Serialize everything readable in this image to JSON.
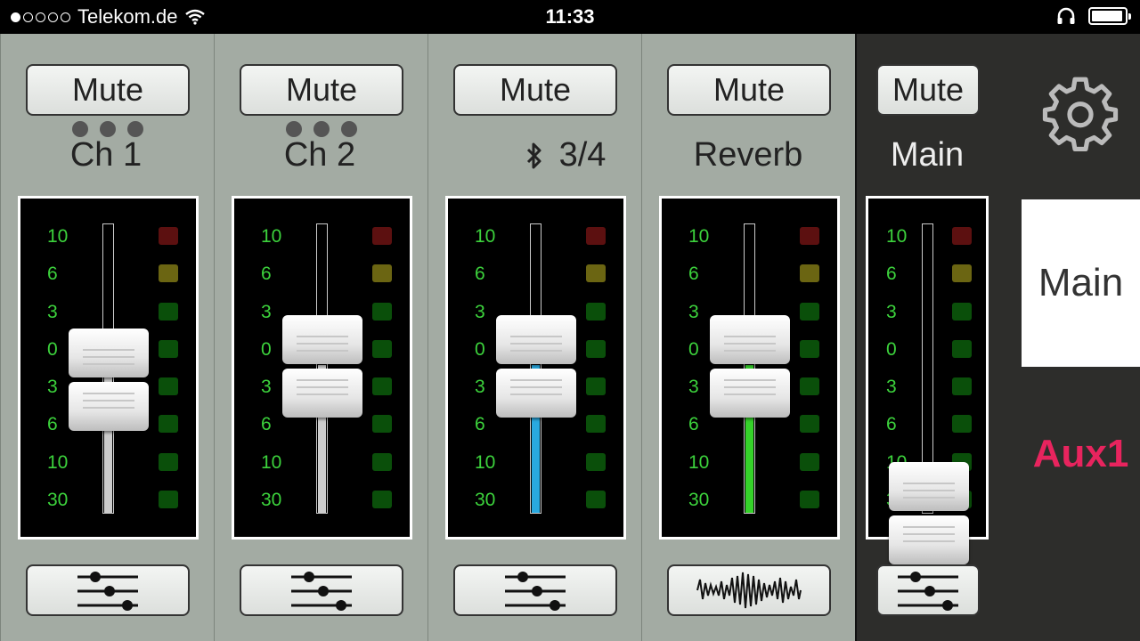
{
  "status_bar": {
    "signal_dots": [
      true,
      false,
      false,
      false,
      false
    ],
    "carrier": "Telekom.de",
    "time": "11:33"
  },
  "channels": [
    {
      "mute_label": "Mute",
      "name": "Ch 1",
      "linked": true,
      "bluetooth": false,
      "fader_color": "#cccccc",
      "edit_icon": "sliders-icon"
    },
    {
      "mute_label": "Mute",
      "name": "Ch 2",
      "linked": true,
      "bluetooth": false,
      "fader_color": "#cccccc",
      "edit_icon": "sliders-icon"
    },
    {
      "mute_label": "Mute",
      "name": "3/4",
      "linked": false,
      "bluetooth": true,
      "fader_color": "#29a9e0",
      "edit_icon": "sliders-icon"
    },
    {
      "mute_label": "Mute",
      "name": "Reverb",
      "linked": false,
      "bluetooth": false,
      "fader_color": "#35d22a",
      "edit_icon": "waveform-icon"
    }
  ],
  "main": {
    "mute_label": "Mute",
    "name": "Main",
    "edit_icon": "sliders-icon"
  },
  "scale_labels": [
    "10",
    "6",
    "3",
    "0",
    "3",
    "6",
    "10",
    "30"
  ],
  "led_colors": [
    "red",
    "yellow",
    "green",
    "green",
    "green",
    "green",
    "green",
    "green"
  ],
  "bus_selector": {
    "main_label": "Main",
    "aux_label": "Aux1",
    "aux_color": "#e8245e"
  },
  "settings_icon": "gear-icon"
}
